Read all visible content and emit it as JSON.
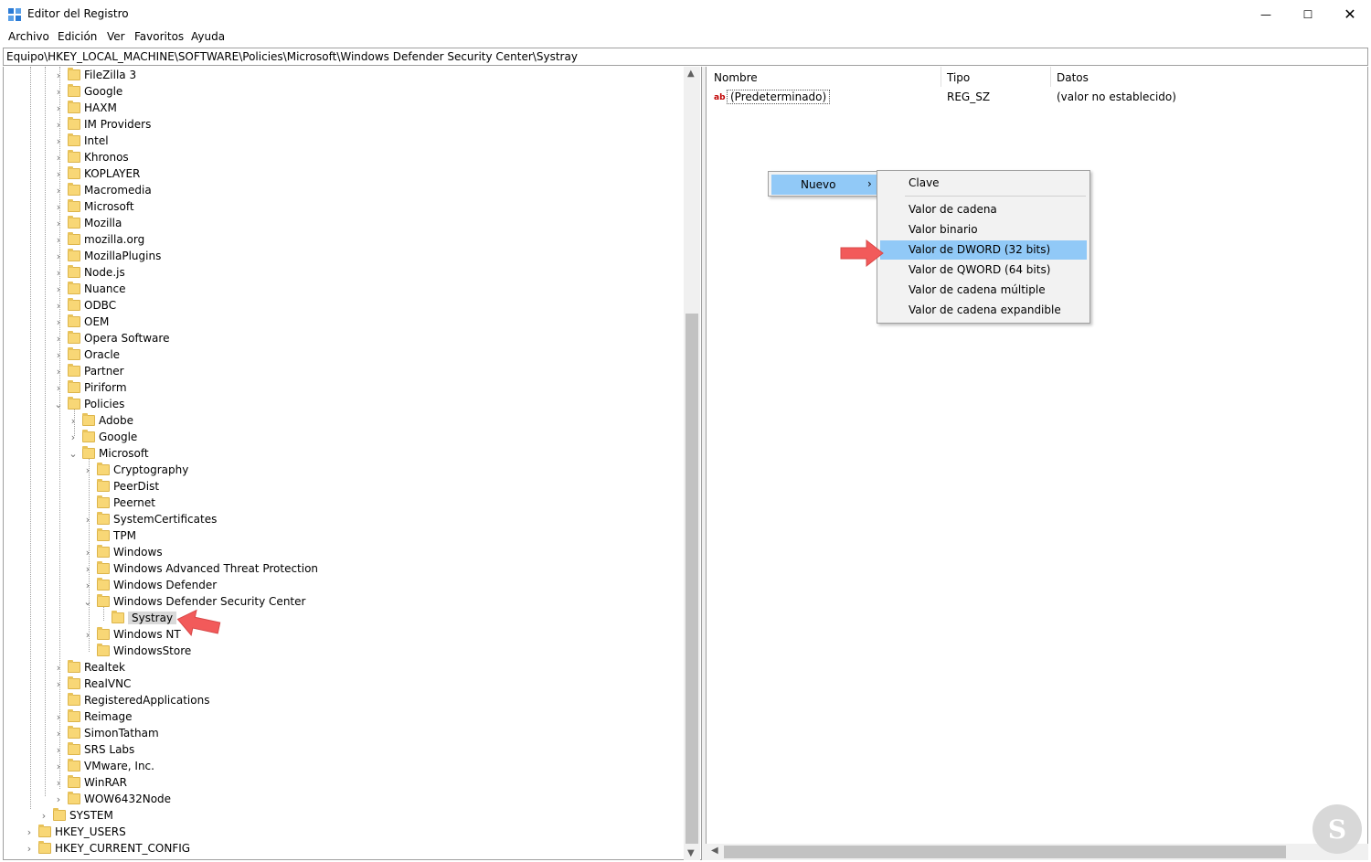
{
  "window": {
    "title": "Editor del Registro",
    "minimize_glyph": "—",
    "maximize_glyph": "☐",
    "close_glyph": "✕"
  },
  "menu": [
    "Archivo",
    "Edición",
    "Ver",
    "Favoritos",
    "Ayuda"
  ],
  "address": "Equipo\\HKEY_LOCAL_MACHINE\\SOFTWARE\\Policies\\Microsoft\\Windows Defender Security Center\\Systray",
  "tree": [
    {
      "label": "FileZilla 3",
      "level": 0,
      "exp": "closed"
    },
    {
      "label": "Google",
      "level": 0,
      "exp": "closed"
    },
    {
      "label": "HAXM",
      "level": 0,
      "exp": "closed"
    },
    {
      "label": "IM Providers",
      "level": 0,
      "exp": "closed"
    },
    {
      "label": "Intel",
      "level": 0,
      "exp": "closed"
    },
    {
      "label": "Khronos",
      "level": 0,
      "exp": "closed"
    },
    {
      "label": "KOPLAYER",
      "level": 0,
      "exp": "closed"
    },
    {
      "label": "Macromedia",
      "level": 0,
      "exp": "closed"
    },
    {
      "label": "Microsoft",
      "level": 0,
      "exp": "closed"
    },
    {
      "label": "Mozilla",
      "level": 0,
      "exp": "closed"
    },
    {
      "label": "mozilla.org",
      "level": 0,
      "exp": "closed"
    },
    {
      "label": "MozillaPlugins",
      "level": 0,
      "exp": "closed"
    },
    {
      "label": "Node.js",
      "level": 0,
      "exp": "closed"
    },
    {
      "label": "Nuance",
      "level": 0,
      "exp": "closed"
    },
    {
      "label": "ODBC",
      "level": 0,
      "exp": "closed"
    },
    {
      "label": "OEM",
      "level": 0,
      "exp": "closed"
    },
    {
      "label": "Opera Software",
      "level": 0,
      "exp": "closed"
    },
    {
      "label": "Oracle",
      "level": 0,
      "exp": "closed"
    },
    {
      "label": "Partner",
      "level": 0,
      "exp": "closed"
    },
    {
      "label": "Piriform",
      "level": 0,
      "exp": "closed"
    },
    {
      "label": "Policies",
      "level": 0,
      "exp": "open"
    },
    {
      "label": "Adobe",
      "level": 1,
      "exp": "closed"
    },
    {
      "label": "Google",
      "level": 1,
      "exp": "closed"
    },
    {
      "label": "Microsoft",
      "level": 1,
      "exp": "open"
    },
    {
      "label": "Cryptography",
      "level": 2,
      "exp": "closed"
    },
    {
      "label": "PeerDist",
      "level": 2,
      "exp": "none"
    },
    {
      "label": "Peernet",
      "level": 2,
      "exp": "none"
    },
    {
      "label": "SystemCertificates",
      "level": 2,
      "exp": "closed"
    },
    {
      "label": "TPM",
      "level": 2,
      "exp": "none"
    },
    {
      "label": "Windows",
      "level": 2,
      "exp": "closed"
    },
    {
      "label": "Windows Advanced Threat Protection",
      "level": 2,
      "exp": "closed"
    },
    {
      "label": "Windows Defender",
      "level": 2,
      "exp": "closed"
    },
    {
      "label": "Windows Defender Security Center",
      "level": 2,
      "exp": "open"
    },
    {
      "label": "Systray",
      "level": 3,
      "exp": "none",
      "selected": true
    },
    {
      "label": "Windows NT",
      "level": 2,
      "exp": "closed"
    },
    {
      "label": "WindowsStore",
      "level": 2,
      "exp": "none"
    },
    {
      "label": "Realtek",
      "level": 0,
      "exp": "closed"
    },
    {
      "label": "RealVNC",
      "level": 0,
      "exp": "closed"
    },
    {
      "label": "RegisteredApplications",
      "level": 0,
      "exp": "none"
    },
    {
      "label": "Reimage",
      "level": 0,
      "exp": "closed"
    },
    {
      "label": "SimonTatham",
      "level": 0,
      "exp": "closed"
    },
    {
      "label": "SRS Labs",
      "level": 0,
      "exp": "closed"
    },
    {
      "label": "VMware, Inc.",
      "level": 0,
      "exp": "closed"
    },
    {
      "label": "WinRAR",
      "level": 0,
      "exp": "closed"
    },
    {
      "label": "WOW6432Node",
      "level": 0,
      "exp": "closed"
    },
    {
      "label": "SYSTEM",
      "level": -1,
      "exp": "closed"
    },
    {
      "label": "HKEY_USERS",
      "level": -2,
      "exp": "closed"
    },
    {
      "label": "HKEY_CURRENT_CONFIG",
      "level": -2,
      "exp": "closed"
    }
  ],
  "list": {
    "columns": [
      "Nombre",
      "Tipo",
      "Datos"
    ],
    "rows": [
      {
        "name": "(Predeterminado)",
        "type": "REG_SZ",
        "data": "(valor no establecido)",
        "icon": "ab-string-icon"
      }
    ]
  },
  "context_menu": {
    "parent_item": "Nuevo",
    "submenu_glyph": "›",
    "items": [
      {
        "label": "Clave"
      },
      {
        "label": "Valor de cadena"
      },
      {
        "label": "Valor binario"
      },
      {
        "label": "Valor de DWORD (32 bits)",
        "highlighted": true
      },
      {
        "label": "Valor de QWORD (64 bits)"
      },
      {
        "label": "Valor de cadena múltiple"
      },
      {
        "label": "Valor de cadena expandible"
      }
    ]
  },
  "watermark_glyph": "S",
  "colors": {
    "menu_highlight": "#91c9f7",
    "annotation_arrow": "#f25a5a",
    "folder": "#f8d776"
  }
}
